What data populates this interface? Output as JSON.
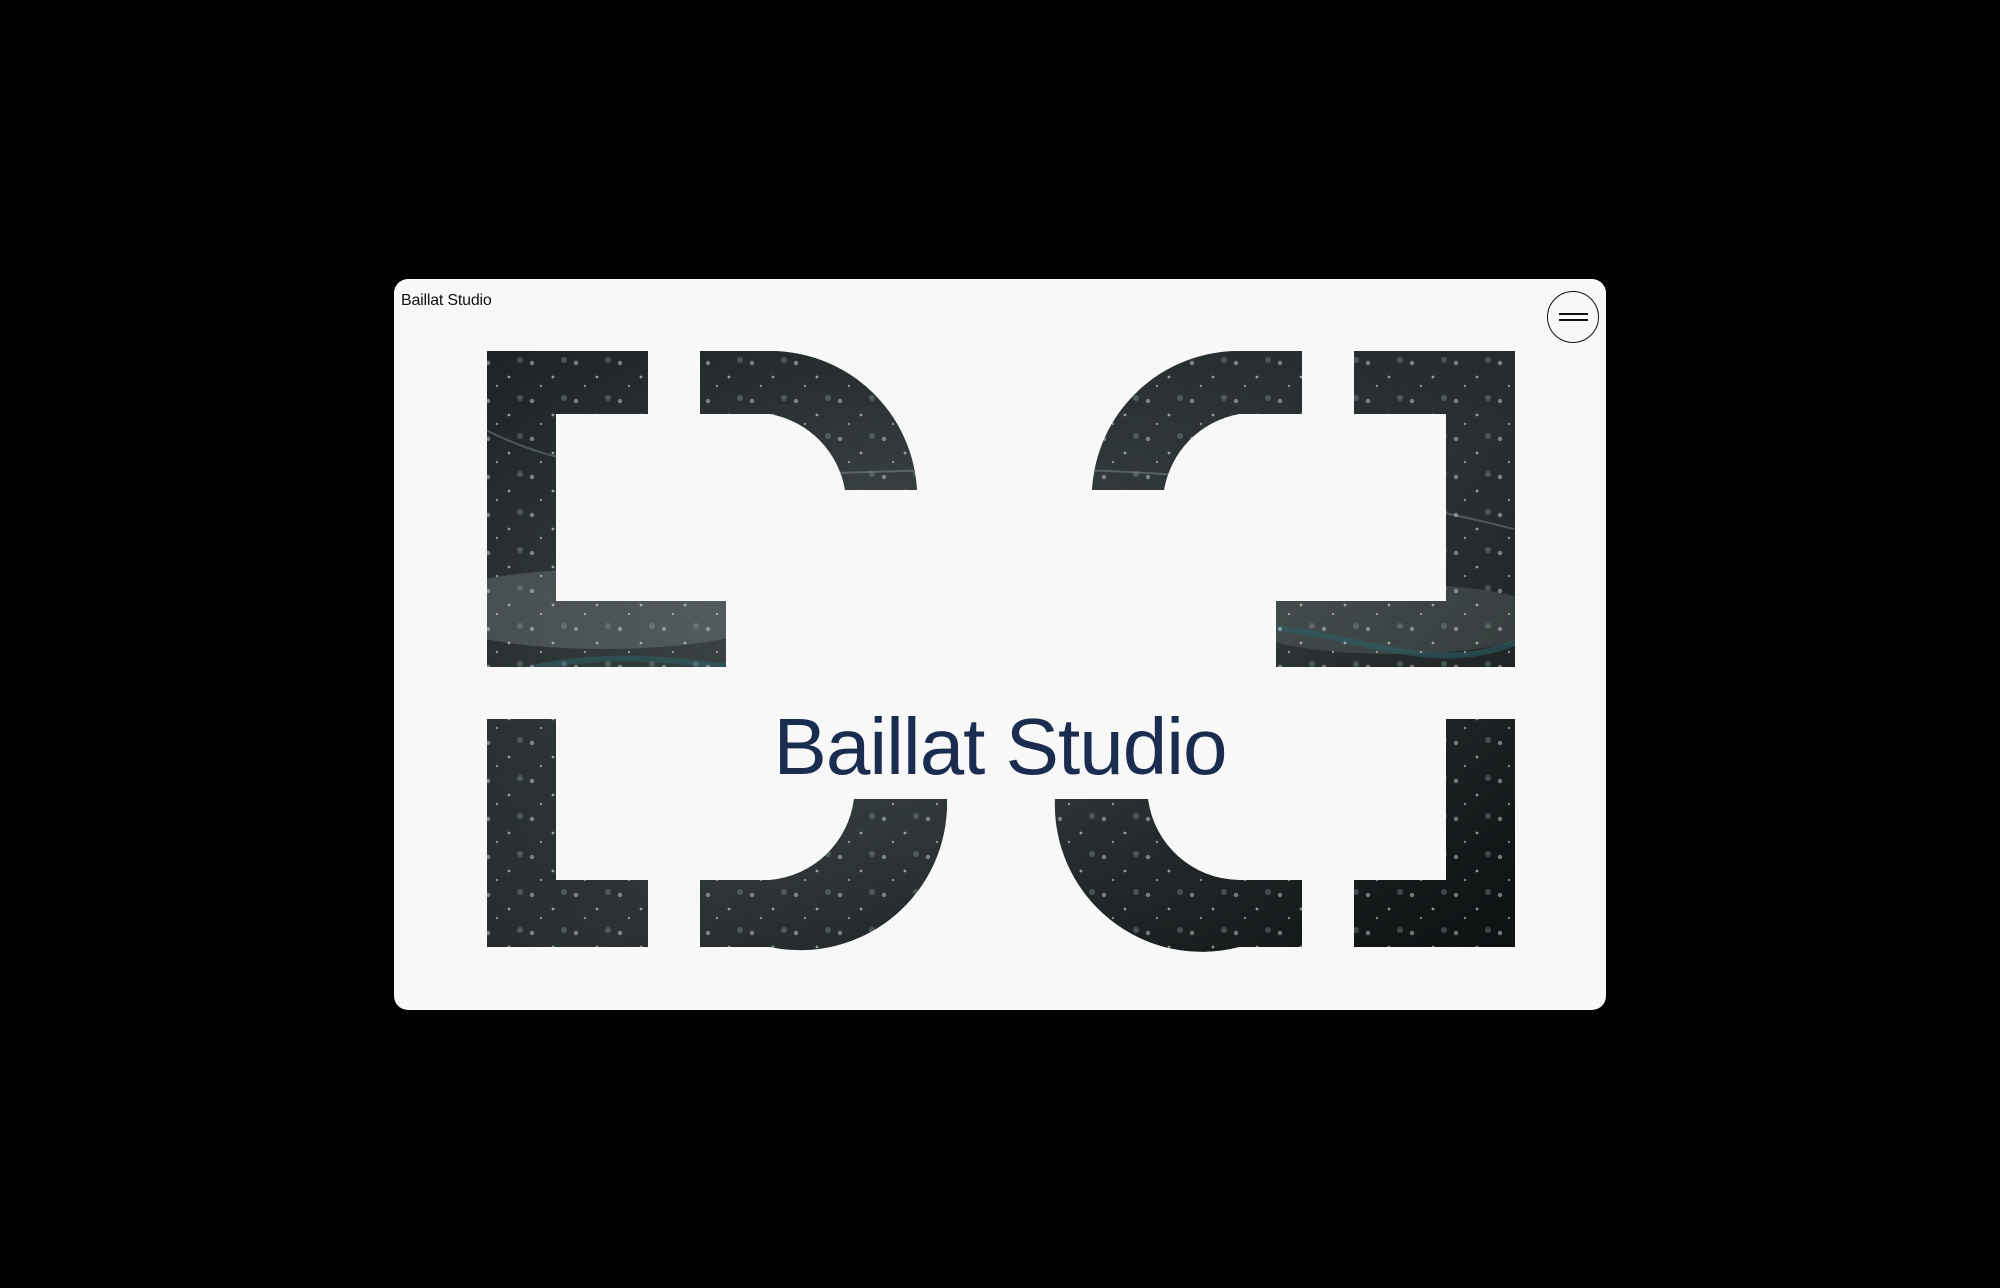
{
  "header": {
    "brand": "Baillat Studio",
    "menu_icon": "hamburger-menu-icon"
  },
  "hero": {
    "wordmark": "Baillat Studio",
    "monogram_icon": "bs-monogram-logo-icon"
  },
  "colors": {
    "page_background": "#000000",
    "card_background": "#f8f8f8",
    "wordmark": "#1a2c4f",
    "texture_dark": "#15191b",
    "texture_teal": "#2d4a4c"
  }
}
